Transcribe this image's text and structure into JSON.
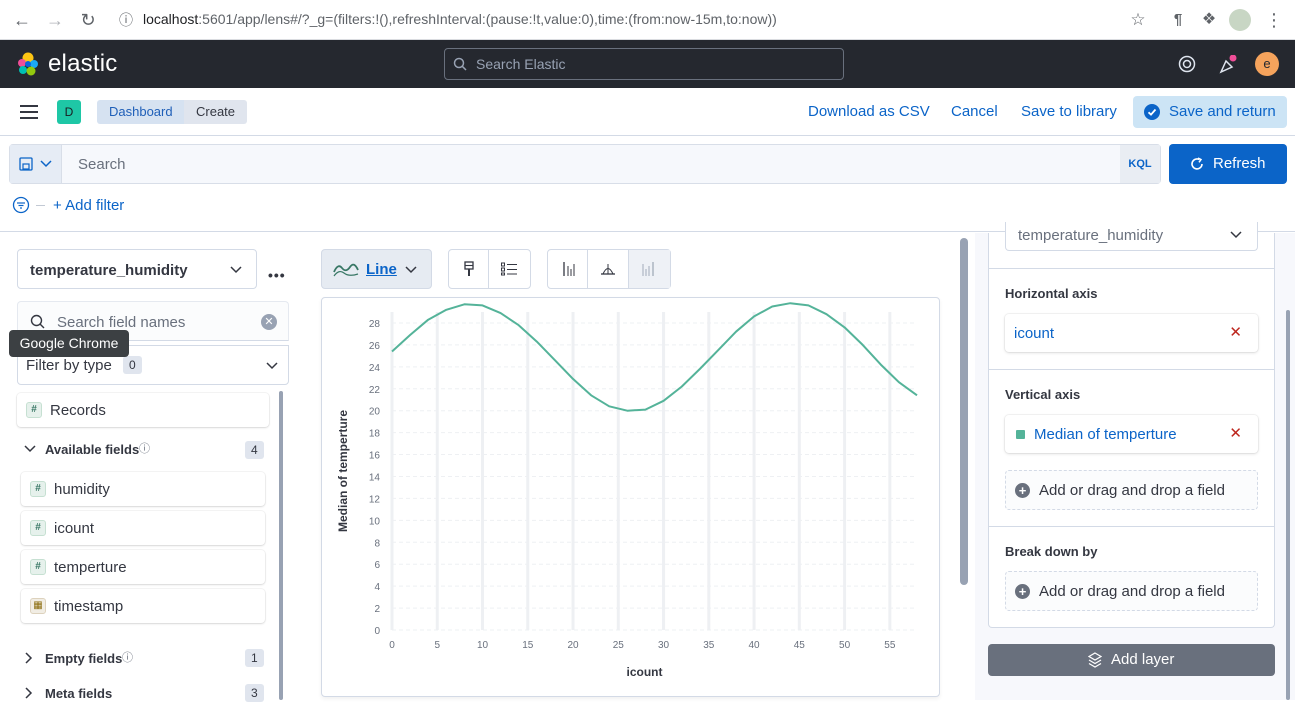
{
  "browser": {
    "url_host": "localhost",
    "url_rest": ":5601/app/lens#/?_g=(filters:!(),refreshInterval:(pause:!t,value:0),time:(from:now-15m,to:now))"
  },
  "header": {
    "logo_text": "elastic",
    "search_placeholder": "Search Elastic",
    "avatar_initial": "e"
  },
  "app_bar": {
    "space_initial": "D",
    "breadcrumbs": [
      "Dashboard",
      "Create"
    ],
    "download_csv": "Download as CSV",
    "cancel": "Cancel",
    "save_to_library": "Save to library",
    "save_and_return": "Save and return"
  },
  "query": {
    "placeholder": "Search",
    "language": "KQL",
    "refresh_label": "Refresh",
    "add_filter_label": "+ Add filter"
  },
  "tooltip": "Google Chrome",
  "left_panel": {
    "index_pattern": "temperature_humidity",
    "field_search_placeholder": "Search field names",
    "filter_by_type": "Filter by type",
    "filter_count": "0",
    "records": "Records",
    "available_fields_label": "Available fields",
    "available_count": "4",
    "fields": [
      {
        "name": "humidity",
        "type": "#"
      },
      {
        "name": "icount",
        "type": "#"
      },
      {
        "name": "temperture",
        "type": "#"
      },
      {
        "name": "timestamp",
        "type": "date"
      }
    ],
    "empty_fields_label": "Empty fields",
    "empty_count": "1",
    "meta_fields_label": "Meta fields",
    "meta_count": "3"
  },
  "toolbar": {
    "chart_type_label": "Line"
  },
  "chart_data": {
    "type": "line",
    "xlabel": "icount",
    "ylabel": "Median of temperture",
    "xlim": [
      0,
      58
    ],
    "ylim": [
      0,
      29
    ],
    "x_ticks": [
      0,
      5,
      10,
      15,
      20,
      25,
      30,
      35,
      40,
      45,
      50,
      55
    ],
    "y_ticks": [
      0,
      2,
      4,
      6,
      8,
      10,
      12,
      14,
      16,
      18,
      20,
      22,
      24,
      26,
      28
    ],
    "color": "#54b399",
    "series": [
      {
        "x": [
          0,
          2,
          4,
          6,
          8,
          10,
          12,
          14,
          16,
          18,
          20,
          22,
          24,
          26,
          28,
          30,
          32,
          34,
          36,
          38,
          40,
          42,
          44,
          46,
          48,
          50,
          52,
          54,
          56,
          58
        ],
        "values": [
          25.4,
          26.9,
          28.3,
          29.2,
          29.7,
          29.6,
          28.9,
          27.8,
          26.3,
          24.6,
          22.9,
          21.4,
          20.4,
          20.0,
          20.1,
          20.9,
          22.2,
          23.8,
          25.5,
          27.2,
          28.6,
          29.5,
          29.8,
          29.6,
          28.8,
          27.6,
          26.0,
          24.2,
          22.6,
          21.4
        ]
      }
    ]
  },
  "right_panel": {
    "index_pattern": "temperature_humidity",
    "horizontal_axis_label": "Horizontal axis",
    "horizontal_field": "icount",
    "vertical_axis_label": "Vertical axis",
    "vertical_field": "Median of temperture",
    "add_drop_label": "Add or drag and drop a field",
    "break_down_label": "Break down by",
    "add_layer": "Add layer"
  }
}
